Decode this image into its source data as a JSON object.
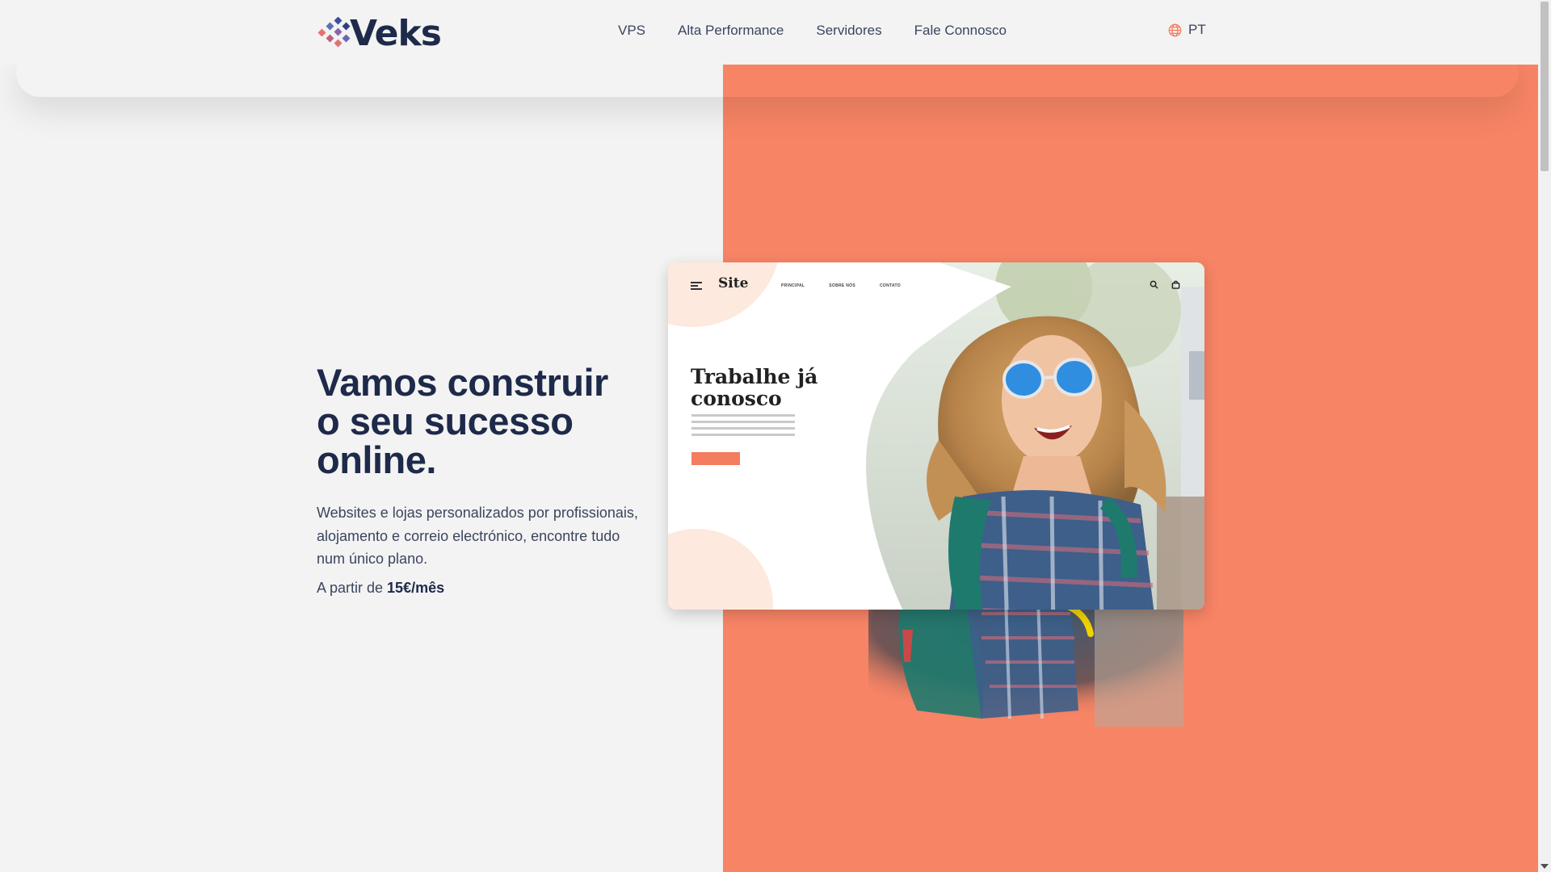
{
  "header": {
    "logo_text": "Veks",
    "nav": [
      "VPS",
      "Alta Performance",
      "Servidores",
      "Fale Connosco"
    ],
    "language": "PT"
  },
  "hero": {
    "title": "Vamos construir o seu sucesso online.",
    "description": "Websites e lojas personalizados por profissionais, alojamento e correio electrónico, encontre tudo num único plano.",
    "price_prefix": "A partir de ",
    "price_value": "15€/mês"
  },
  "mockup": {
    "site_name": "Site",
    "links": [
      "PRINCIPAL",
      "SOBRE NÓS",
      "CONTATO"
    ],
    "headline_line1": "Trabalhe já",
    "headline_line2": "conosco"
  },
  "colors": {
    "accent": "#f78465",
    "text_dark": "#1e2a4a",
    "background": "#f3f3f3"
  },
  "icons": [
    "logo-mark-icon",
    "globe-icon",
    "menu-icon",
    "search-icon",
    "bag-icon"
  ]
}
